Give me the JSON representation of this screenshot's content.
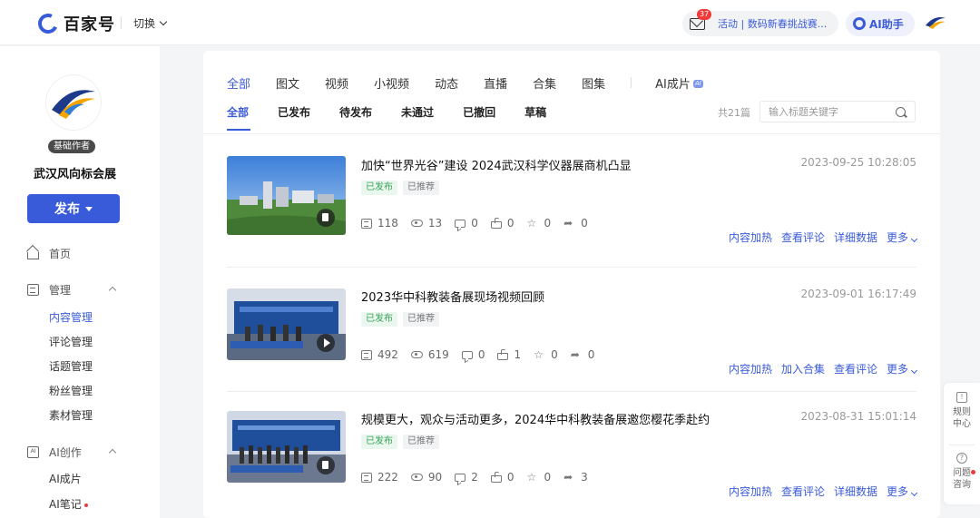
{
  "header": {
    "logo_text": "百家号",
    "switch_label": "切换",
    "mail_badge": "37",
    "notice_text": "活动 | 数码新春挑战赛...",
    "ai_helper_label": "AI助手"
  },
  "sidebar": {
    "badge": "基础作者",
    "author_name": "武汉风向标会展",
    "publish_label": "发布",
    "home_label": "首页",
    "manage_label": "管理",
    "manage_items": [
      "内容管理",
      "评论管理",
      "话题管理",
      "粉丝管理",
      "素材管理"
    ],
    "ai_label": "AI创作",
    "ai_items": [
      "AI成片",
      "AI笔记"
    ]
  },
  "main": {
    "tabs": [
      "全部",
      "图文",
      "视频",
      "小视频",
      "动态",
      "直播",
      "合集",
      "图集",
      "AI成片"
    ],
    "ai_tag": "AI",
    "subtabs": [
      "全部",
      "已发布",
      "待发布",
      "未通过",
      "已撤回",
      "草稿"
    ],
    "count": "共21篇",
    "search_placeholder": "输入标题关键字",
    "items": [
      {
        "title": "加快“世界光谷”建设 2024武汉科学仪器展商机凸显",
        "date": "2023-09-25 10:28:05",
        "tags": [
          "已发布",
          "已推荐"
        ],
        "stats": [
          "118",
          "13",
          "0",
          "0",
          "0",
          "0"
        ],
        "actions": [
          "内容加热",
          "查看评论",
          "详细数据",
          "更多"
        ]
      },
      {
        "title": "2023华中科教装备展现场视频回顾",
        "date": "2023-09-01 16:17:49",
        "tags": [
          "已发布",
          "已推荐"
        ],
        "stats": [
          "492",
          "619",
          "0",
          "1",
          "0",
          "0"
        ],
        "actions": [
          "内容加热",
          "加入合集",
          "查看评论",
          "更多"
        ]
      },
      {
        "title": "规模更大，观众与活动更多，2024华中科教装备展邀您樱花季赴约",
        "date": "2023-08-31 15:01:14",
        "tags": [
          "已发布",
          "已推荐"
        ],
        "stats": [
          "222",
          "90",
          "2",
          "0",
          "0",
          "3"
        ],
        "actions": [
          "内容加热",
          "查看评论",
          "详细数据",
          "更多"
        ]
      }
    ]
  },
  "float": {
    "rules": "规则中心",
    "help": "问题咨询"
  },
  "colors": {
    "accent": "#3a5bd9",
    "published": "#3aa35a",
    "red": "#f03a3a"
  }
}
